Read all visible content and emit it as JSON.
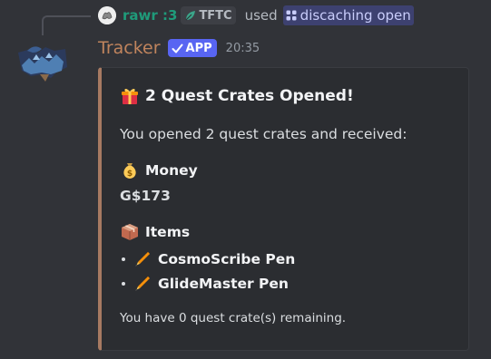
{
  "reply": {
    "username": "rawr :3",
    "guild_tag": "TFTC",
    "used_text": "used",
    "command": "discaching open"
  },
  "author": {
    "name": "Tracker",
    "badge": "APP",
    "timestamp": "20:35"
  },
  "embed": {
    "accent_color": "#a77a62",
    "title": "2 Quest Crates Opened!",
    "title_icon": "gift-icon",
    "description": "You opened 2 quest crates and received:",
    "money": {
      "icon": "money-bag-icon",
      "name": "Money",
      "value": "G$173"
    },
    "items": {
      "icon": "package-icon",
      "name": "Items",
      "list": [
        {
          "icon": "pen-icon",
          "label": "CosmoScribe Pen"
        },
        {
          "icon": "pen-icon",
          "label": "GlideMaster Pen"
        }
      ]
    },
    "footer": "You have 0 quest crate(s) remaining."
  },
  "colors": {
    "background": "#313338",
    "embed_background": "#2b2d31",
    "username": "#c0845d",
    "reply_username": "#1f9b7a",
    "app_badge": "#5865f2"
  }
}
